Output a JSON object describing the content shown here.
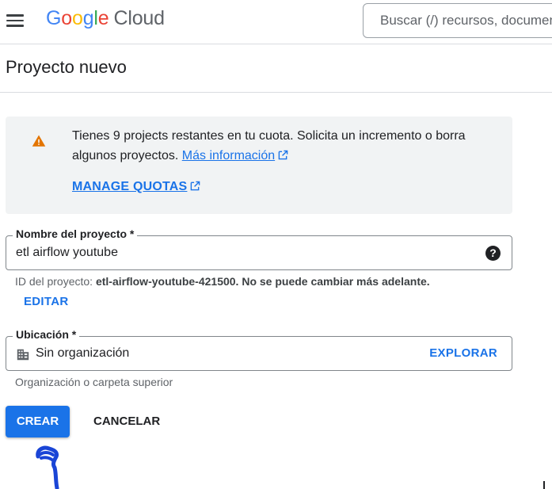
{
  "header": {
    "logo": {
      "google": [
        "G",
        "o",
        "o",
        "g",
        "l",
        "e"
      ],
      "product": "Cloud"
    },
    "search_placeholder": "Buscar (/) recursos, documentos, productos y más"
  },
  "page": {
    "title": "Proyecto nuevo"
  },
  "notice": {
    "text": "Tienes 9 projects restantes en tu cuota. Solicita un incremento o borra algunos proyectos.",
    "more_info_link": "Más información",
    "manage_quotas_link": "MANAGE QUOTAS",
    "icon": "warning-icon",
    "icon_color": "#e37400"
  },
  "project_name": {
    "label": "Nombre del proyecto *",
    "value": "etl airflow youtube",
    "help_icon": "?"
  },
  "project_id": {
    "prefix": "ID del proyecto:",
    "value": "etl-airflow-youtube-421500.",
    "suffix": "No se puede cambiar más adelante.",
    "edit_button": "EDITAR"
  },
  "location": {
    "label": "Ubicación *",
    "value": "Sin organización",
    "browse_button": "EXPLORAR",
    "hint": "Organización o carpeta superior",
    "icon": "organization-icon"
  },
  "actions": {
    "create_label": "CREAR",
    "cancel_label": "CANCELAR"
  },
  "colors": {
    "accent": "#1a73e8",
    "annotation": "#1a45d6"
  }
}
